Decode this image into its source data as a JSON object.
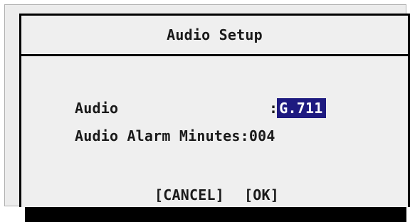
{
  "dialog": {
    "title": "Audio Setup"
  },
  "fields": {
    "audio": {
      "label": "Audio",
      "separator": ":",
      "value": "G.711"
    },
    "alarm_minutes": {
      "label": "Audio Alarm Minutes",
      "separator": ":",
      "value": "004"
    }
  },
  "buttons": {
    "cancel_label": "[CANCEL]",
    "ok_label": "[OK]"
  },
  "colors": {
    "selection_background": "#1e1a80",
    "selection_text": "#ffffff",
    "panel_background": "#efefef",
    "border": "#000000"
  }
}
